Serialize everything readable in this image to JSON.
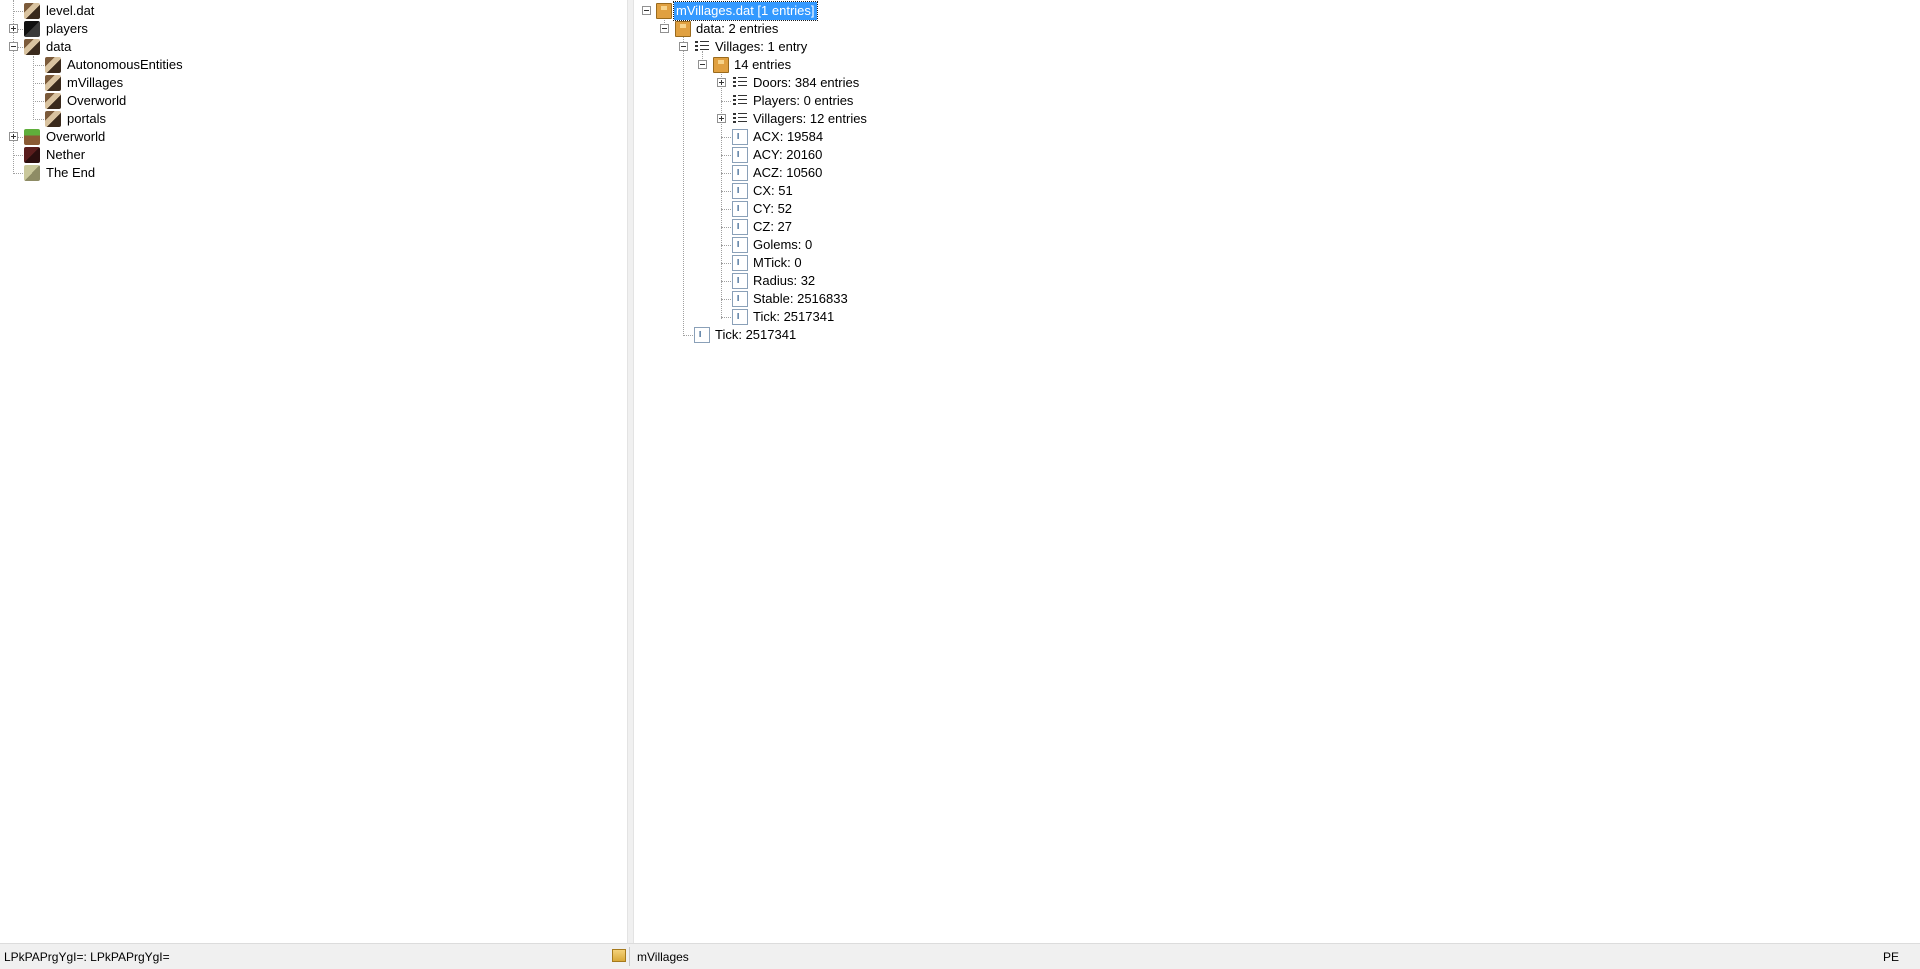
{
  "left_tree": [
    {
      "label": "level.dat",
      "icon": "book-icon"
    },
    {
      "label": "players",
      "icon": "dark-cube-icon"
    },
    {
      "label": "data",
      "icon": "book-icon"
    },
    {
      "label": "AutonomousEntities",
      "icon": "book-icon"
    },
    {
      "label": "mVillages",
      "icon": "book-icon"
    },
    {
      "label": "Overworld",
      "icon": "book-icon"
    },
    {
      "label": "portals",
      "icon": "book-icon"
    },
    {
      "label": "Overworld",
      "icon": "grass-cube-icon"
    },
    {
      "label": "Nether",
      "icon": "nether-cube-icon"
    },
    {
      "label": "The End",
      "icon": "end-cube-icon"
    }
  ],
  "right_tree": [
    {
      "label": "mVillages.dat [1 entries]",
      "icon": "compound-icon"
    },
    {
      "label": "data: 2 entries",
      "icon": "compound-icon"
    },
    {
      "label": "Villages: 1 entry",
      "icon": "list-icon"
    },
    {
      "label": "14 entries",
      "icon": "compound-icon"
    },
    {
      "label": "Doors: 384 entries",
      "icon": "list-icon"
    },
    {
      "label": "Players: 0 entries",
      "icon": "list-icon"
    },
    {
      "label": "Villagers: 12 entries",
      "icon": "list-icon"
    },
    {
      "label": "ACX: 19584",
      "icon": "int-tag-icon"
    },
    {
      "label": "ACY: 20160",
      "icon": "int-tag-icon"
    },
    {
      "label": "ACZ: 10560",
      "icon": "int-tag-icon"
    },
    {
      "label": "CX: 51",
      "icon": "int-tag-icon"
    },
    {
      "label": "CY: 52",
      "icon": "int-tag-icon"
    },
    {
      "label": "CZ: 27",
      "icon": "int-tag-icon"
    },
    {
      "label": "Golems: 0",
      "icon": "int-tag-icon"
    },
    {
      "label": "MTick: 0",
      "icon": "int-tag-icon"
    },
    {
      "label": "Radius: 32",
      "icon": "int-tag-icon"
    },
    {
      "label": "Stable: 2516833",
      "icon": "int-tag-icon"
    },
    {
      "label": "Tick: 2517341",
      "icon": "int-tag-icon"
    },
    {
      "label": "Tick: 2517341",
      "icon": "int-tag-icon"
    }
  ],
  "statusbar": {
    "left_text": "LPkPAPrgYgI=: LPkPAPrgYgI=",
    "folder_icon": "folder-icon",
    "mid_text": "mVillages",
    "right_text": "PE"
  },
  "colors": {
    "selection": "#3399ff",
    "statusbar_bg": "#f0f0f0"
  }
}
